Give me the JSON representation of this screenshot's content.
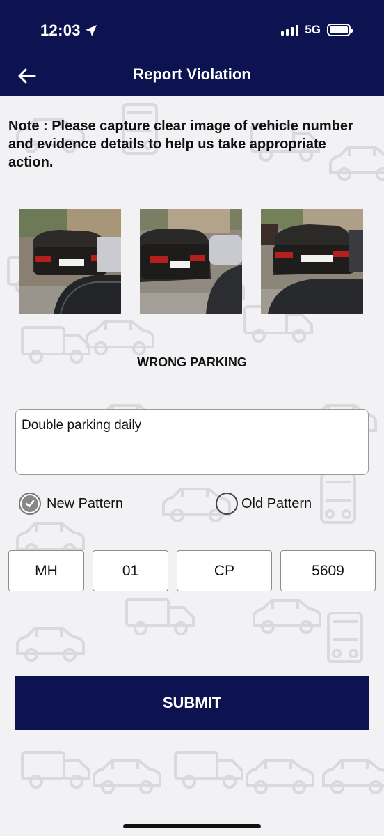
{
  "status_bar": {
    "time": "12:03",
    "network": "5G",
    "location_icon": "location-arrow-icon",
    "signal_icon": "signal-bars-icon",
    "battery_icon": "battery-icon"
  },
  "header": {
    "title": "Report Violation",
    "back_icon": "back-arrow-icon",
    "background": "#0c1350"
  },
  "note": "Note : Please capture clear image of vehicle number and evidence details to help us take appropriate action.",
  "photos": [
    {
      "icon": "vehicle-photo-1"
    },
    {
      "icon": "vehicle-photo-2"
    },
    {
      "icon": "vehicle-photo-3"
    }
  ],
  "violation_type": "WRONG PARKING",
  "description": {
    "value": "Double parking daily"
  },
  "pattern": {
    "options": [
      {
        "label": "New Pattern",
        "selected": true
      },
      {
        "label": "Old Pattern",
        "selected": false
      }
    ]
  },
  "plate": {
    "state": "MH",
    "district": "01",
    "series": "CP",
    "number": "5609"
  },
  "submit_label": "SUBMIT",
  "colors": {
    "primary": "#0c1350",
    "background": "#f2f2f4"
  }
}
